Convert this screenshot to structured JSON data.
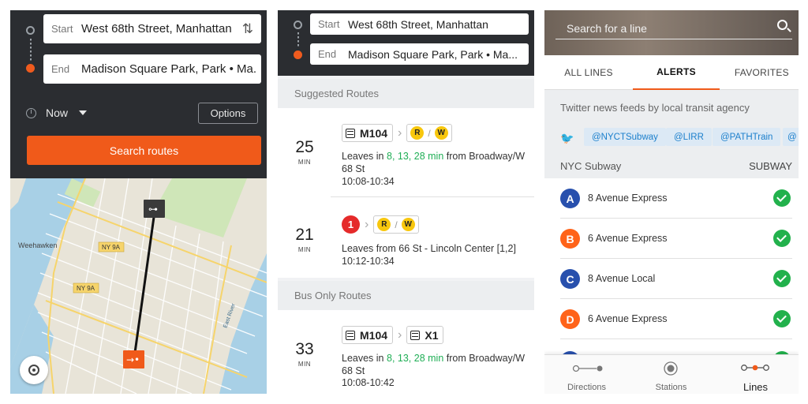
{
  "planner": {
    "start_label": "Start",
    "start_value": "West 68th Street, Manhattan",
    "end_label": "End",
    "end_value": "Madison Square Park, Park • Ma...",
    "time_label": "Now",
    "options_label": "Options",
    "search_label": "Search routes"
  },
  "map": {
    "labels": [
      "Weehawken",
      "NY 9A",
      "NY 9A",
      "East River"
    ]
  },
  "routes_panel": {
    "start_label": "Start",
    "start_value": "West 68th Street, Manhattan",
    "end_label": "End",
    "end_value": "Madison Square Park, Park • Ma...",
    "suggested_header": "Suggested Routes",
    "bus_only_header": "Bus Only Routes",
    "min_label": "MIN",
    "routes": [
      {
        "minutes": "25",
        "bus": "M104",
        "trains": [
          "R",
          "W"
        ],
        "leaves_prefix": "Leaves in",
        "leaves_times": "8, 13, 28 min",
        "leaves_suffix": "from Broadway/W 68 St",
        "time_range": "10:08-10:34"
      },
      {
        "minutes": "21",
        "red_line": "1",
        "trains": [
          "R",
          "W"
        ],
        "leaves_text": "Leaves from 66 St - Lincoln Center [1,2]",
        "time_range": "10:12-10:34"
      },
      {
        "minutes": "33",
        "bus": "M104",
        "bus2": "X1",
        "leaves_prefix": "Leaves in",
        "leaves_times": "8, 13, 28 min",
        "leaves_suffix": "from Broadway/W 68 St",
        "time_range": "10:08-10:42"
      }
    ]
  },
  "lines_panel": {
    "search_placeholder": "Search for a line",
    "tabs": [
      "ALL LINES",
      "ALERTS",
      "FAVORITES"
    ],
    "active_tab": "ALERTS",
    "twitter_header": "Twitter news feeds by local transit agency",
    "handles": [
      "@NYCTSubway",
      "@LIRR",
      "@PATHTrain",
      "@"
    ],
    "agency_name": "NYC Subway",
    "agency_type": "SUBWAY",
    "lines": [
      {
        "letter": "A",
        "name": "8 Avenue Express",
        "color": "#2850ad"
      },
      {
        "letter": "B",
        "name": "6 Avenue Express",
        "color": "#ff6319"
      },
      {
        "letter": "C",
        "name": "8 Avenue Local",
        "color": "#2850ad"
      },
      {
        "letter": "D",
        "name": "6 Avenue Express",
        "color": "#ff6319"
      }
    ],
    "nav": [
      "Directions",
      "Stations",
      "Lines"
    ],
    "active_nav": "Lines"
  },
  "colors": {
    "accent": "#f05a1a",
    "dark": "#2b2d31",
    "success": "#22b14c",
    "twitter": "#1da1f2"
  }
}
